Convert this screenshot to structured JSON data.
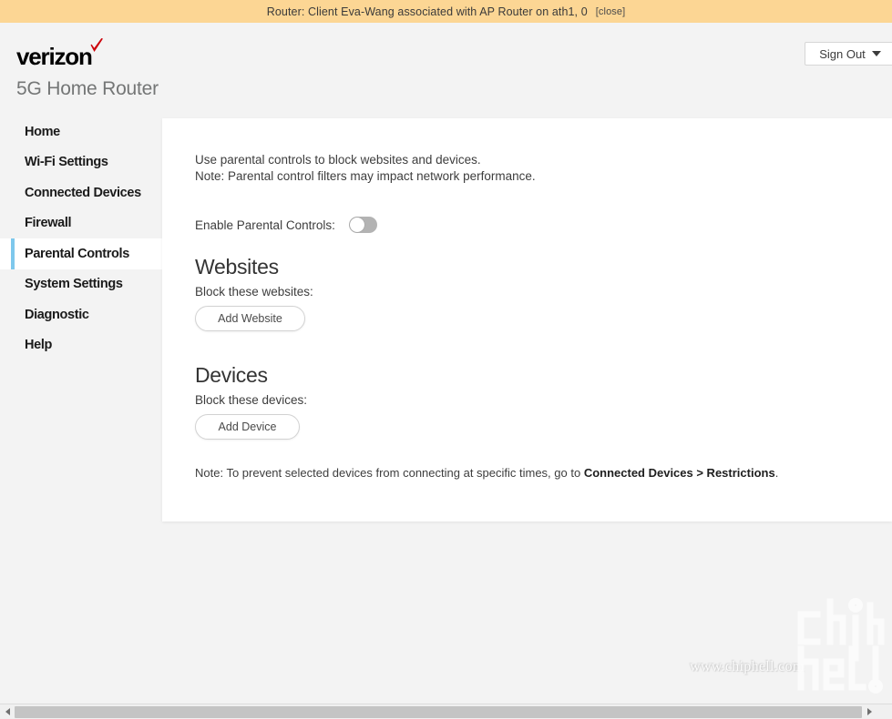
{
  "notification": {
    "message": "Router: Client Eva-Wang associated with AP Router on ath1, 0",
    "close_label": "[close]",
    "background_color": "#fcd694"
  },
  "header": {
    "brand_name": "verizon",
    "brand_check_color": "#cd040b",
    "product_name": "5G Home Router",
    "sign_out_label": "Sign Out"
  },
  "sidebar": {
    "active_accent_color": "#7ec8ec",
    "items": [
      {
        "label": "Home",
        "active": false
      },
      {
        "label": "Wi-Fi Settings",
        "active": false
      },
      {
        "label": "Connected Devices",
        "active": false
      },
      {
        "label": "Firewall",
        "active": false
      },
      {
        "label": "Parental Controls",
        "active": true
      },
      {
        "label": "System Settings",
        "active": false
      },
      {
        "label": "Diagnostic",
        "active": false
      },
      {
        "label": "Help",
        "active": false
      }
    ]
  },
  "main": {
    "intro_line_1": "Use parental controls to block websites and devices.",
    "intro_line_2": "Note: Parental control filters may impact network performance.",
    "enable_label": "Enable Parental Controls:",
    "enable_state": "off",
    "websites": {
      "title": "Websites",
      "subtitle": "Block these websites:",
      "add_button_label": "Add Website"
    },
    "devices": {
      "title": "Devices",
      "subtitle": "Block these devices:",
      "add_button_label": "Add Device"
    },
    "footnote_prefix": "Note: To prevent selected devices from connecting at specific times, go to ",
    "footnote_link": "Connected Devices > Restrictions",
    "footnote_suffix": "."
  },
  "watermark": {
    "url": "www.chiphell.com",
    "logo_text": "chiphell"
  }
}
